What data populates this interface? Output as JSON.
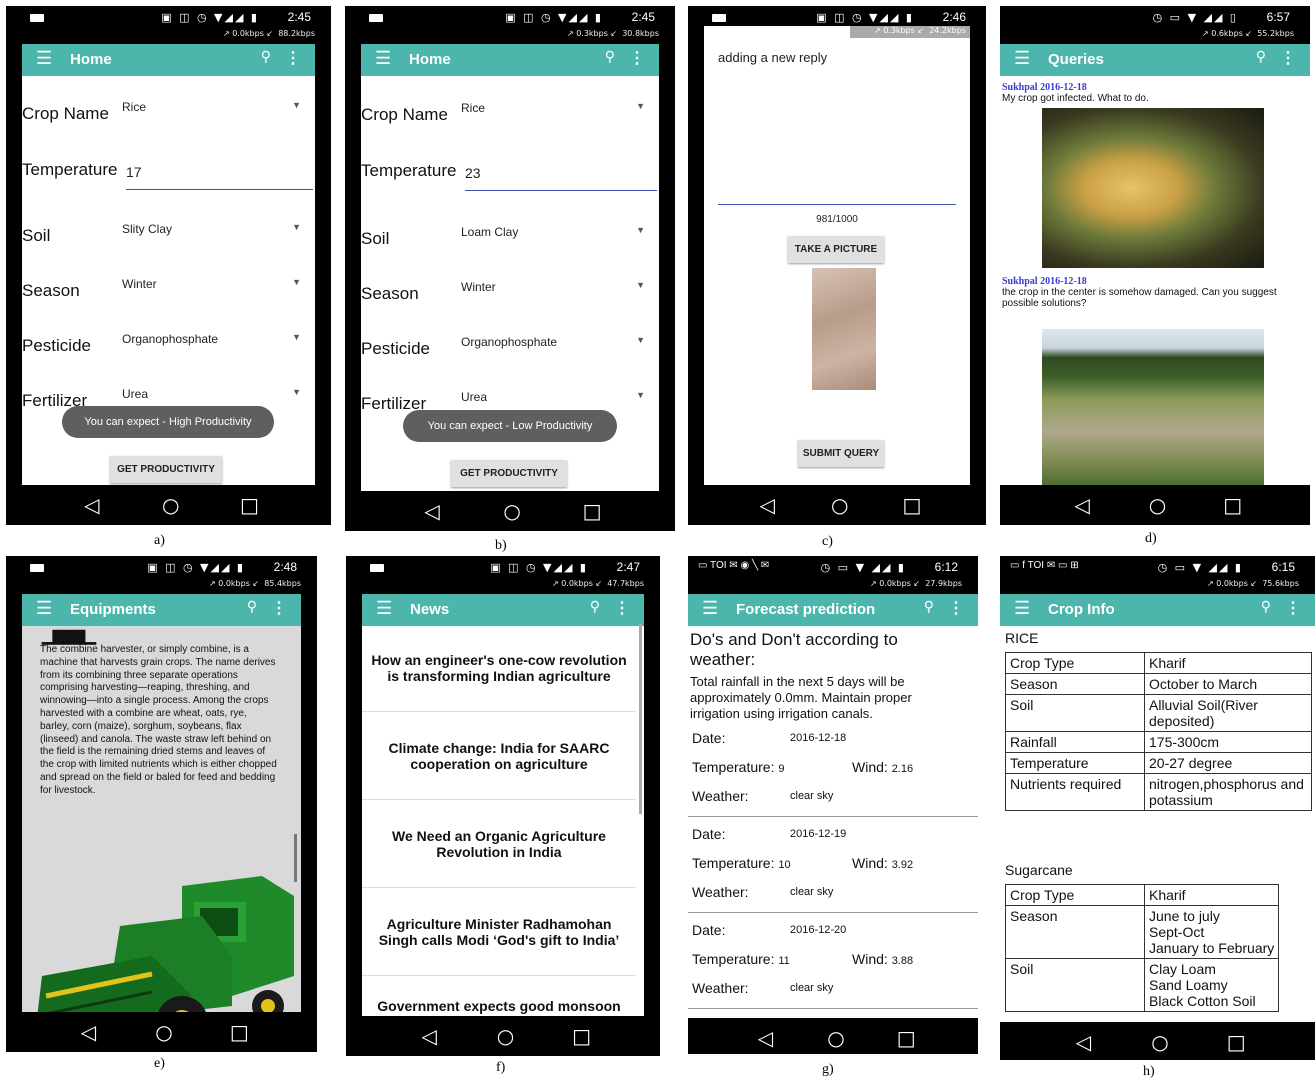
{
  "status": {
    "a": {
      "time": "2:45",
      "up": "0.0kbps",
      "down": "88.2kbps"
    },
    "b": {
      "time": "2:45",
      "up": "0.3kbps",
      "down": "30.8kbps"
    },
    "c": {
      "time": "2:46",
      "up": "0.3kbps",
      "down": "24.2kbps"
    },
    "d": {
      "time": "6:57",
      "up": "0.6kbps",
      "down": "55.2kbps"
    },
    "e": {
      "time": "2:48",
      "up": "0.0kbps",
      "down": "85.4kbps"
    },
    "f": {
      "time": "2:47",
      "up": "0.0kbps",
      "down": "47.7kbps"
    },
    "g": {
      "time": "6:12",
      "up": "0.0kbps",
      "down": "27.9kbps"
    },
    "h": {
      "time": "6:15",
      "up": "0.0kbps",
      "down": "75.6kbps"
    }
  },
  "captions": {
    "a": "a)",
    "b": "b)",
    "c": "c)",
    "d": "d)",
    "e": "e)",
    "f": "f)",
    "g": "g)",
    "h": "h)"
  },
  "icons": {
    "menu": "hamburger-menu-icon",
    "search": "search-icon",
    "more": "overflow-menu-icon",
    "back": "back-triangle-icon",
    "home": "home-circle-icon",
    "recents": "recents-square-icon",
    "dropdown": "dropdown-arrow-icon"
  },
  "colors": {
    "appbar": "#4db6ac",
    "underline": "#3f51b5",
    "toast": "#5f5f5f",
    "username": "#3a3acb"
  },
  "screen_a": {
    "title": "Home",
    "fields": [
      {
        "label": "Crop Name",
        "value": "Rice"
      },
      {
        "label": "Temperature",
        "value": "17"
      },
      {
        "label": "Soil",
        "value": "Slity Clay"
      },
      {
        "label": "Season",
        "value": "Winter"
      },
      {
        "label": "Pesticide",
        "value": "Organophosphate"
      },
      {
        "label": "Fertilizer",
        "value": "Urea"
      }
    ],
    "toast": "You can expect - High Productivity",
    "button": "GET PRODUCTIVITY"
  },
  "screen_b": {
    "title": "Home",
    "fields": [
      {
        "label": "Crop Name",
        "value": "Rice"
      },
      {
        "label": "Temperature",
        "value": "23"
      },
      {
        "label": "Soil",
        "value": "Loam Clay"
      },
      {
        "label": "Season",
        "value": "Winter"
      },
      {
        "label": "Pesticide",
        "value": "Organophosphate"
      },
      {
        "label": "Fertilizer",
        "value": "Urea"
      }
    ],
    "toast": "You can expect - Low Productivity",
    "button": "GET PRODUCTIVITY"
  },
  "screen_c": {
    "reply_text": "adding a new reply",
    "counter": "981/1000",
    "take_picture": "TAKE A PICTURE",
    "submit": "SUBMIT QUERY"
  },
  "screen_d": {
    "title": "Queries",
    "queries": [
      {
        "header": "Sukhpal 2016-12-18",
        "text": "My crop got infected. What to do."
      },
      {
        "header": "Sukhpal 2016-12-18",
        "text": "the crop in the center is somehow damaged. Can you suggest possible solutions?"
      }
    ]
  },
  "screen_e": {
    "title": "Equipments",
    "body": "The combine harvester, or simply combine, is a machine that harvests grain crops. The name derives from its combining three separate operations comprising harvesting—reaping, threshing, and winnowing—into a single process. Among the crops harvested with a combine are wheat, oats, rye, barley, corn (maize), sorghum, soybeans, flax (linseed) and canola. The waste straw left behind on the field is the remaining dried stems and leaves of the crop with limited nutrients which is either chopped and spread on the field or baled for feed and bedding for livestock."
  },
  "screen_f": {
    "title": "News",
    "items": [
      "How an engineer's one-cow revolution is transforming Indian agriculture",
      "Climate change: India for SAARC cooperation on agriculture",
      "We Need an Organic Agriculture Revolution in India",
      "Agriculture Minister Radhamohan Singh calls Modi ‘God's gift to India’",
      "Government expects good monsoon"
    ]
  },
  "screen_g": {
    "title": "Forecast prediction",
    "heading": "Do's and Don't according to weather:",
    "advice": "Total rainfall in the next 5 days will be approximately 0.0mm. Maintain proper irrigation using irrigation canals.",
    "labels": {
      "date": "Date:",
      "temperature": "Temperature:",
      "wind": "Wind:",
      "weather": "Weather:"
    },
    "days": [
      {
        "date": "2016-12-18",
        "temperature": "9",
        "wind": "2.16",
        "weather": "clear sky"
      },
      {
        "date": "2016-12-19",
        "temperature": "10",
        "wind": "3.92",
        "weather": "clear sky"
      },
      {
        "date": "2016-12-20",
        "temperature": "11",
        "wind": "3.88",
        "weather": "clear sky"
      }
    ]
  },
  "screen_h": {
    "title": "Crop Info",
    "crop1": {
      "name": "RICE",
      "rows": [
        {
          "k": "Crop Type",
          "v": "Kharif"
        },
        {
          "k": "Season",
          "v": "October to March"
        },
        {
          "k": "Soil",
          "v": "Alluvial Soil(River deposited)"
        },
        {
          "k": "Rainfall",
          "v": "175-300cm"
        },
        {
          "k": "Temperature",
          "v": "20-27 degree"
        },
        {
          "k": "Nutrients required",
          "v": "nitrogen,phosphorus and potassium"
        }
      ]
    },
    "crop2": {
      "name": "Sugarcane",
      "rows": [
        {
          "k": "Crop Type",
          "v": "Kharif"
        },
        {
          "k": "Season",
          "v": "June to july\nSept-Oct\nJanuary to February"
        },
        {
          "k": "Soil",
          "v": "Clay Loam\nSand Loamy\nBlack Cotton Soil"
        }
      ]
    }
  }
}
